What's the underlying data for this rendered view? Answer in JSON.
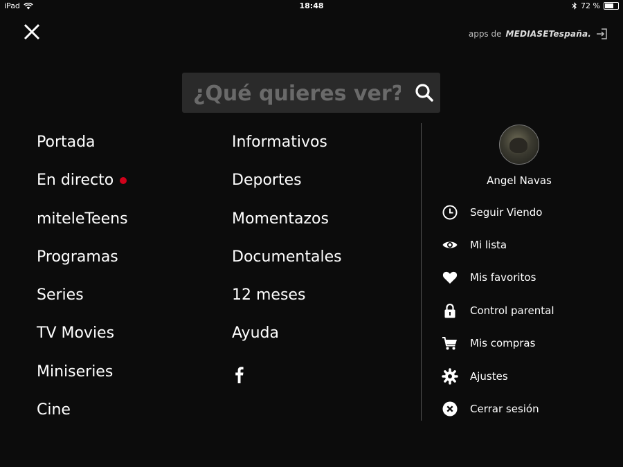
{
  "status_bar": {
    "device": "iPad",
    "time": "18:48",
    "battery_text": "72 %",
    "battery_level": 0.72
  },
  "header": {
    "brand_prefix": "apps de",
    "brand_name": "MEDIASETespaña."
  },
  "search": {
    "placeholder": "¿Qué quieres ver?"
  },
  "menu": {
    "column1": [
      {
        "label": "Portada"
      },
      {
        "label": "En directo",
        "live": true
      },
      {
        "label": "miteleTeens"
      },
      {
        "label": "Programas"
      },
      {
        "label": "Series"
      },
      {
        "label": "TV Movies"
      },
      {
        "label": "Miniseries"
      },
      {
        "label": "Cine"
      }
    ],
    "column2": [
      {
        "label": "Informativos"
      },
      {
        "label": "Deportes"
      },
      {
        "label": "Momentazos"
      },
      {
        "label": "Documentales"
      },
      {
        "label": "12 meses"
      },
      {
        "label": "Ayuda"
      }
    ],
    "social_icon": "facebook-icon"
  },
  "profile": {
    "name": "Angel Navas"
  },
  "account_menu": [
    {
      "label": "Seguir Viendo",
      "icon": "clock-icon"
    },
    {
      "label": "Mi lista",
      "icon": "eye-icon"
    },
    {
      "label": "Mis favoritos",
      "icon": "heart-icon"
    },
    {
      "label": "Control parental",
      "icon": "lock-icon"
    },
    {
      "label": "Mis compras",
      "icon": "cart-icon"
    },
    {
      "label": "Ajustes",
      "icon": "gear-icon"
    },
    {
      "label": "Cerrar sesión",
      "icon": "close-circle-icon"
    }
  ],
  "colors": {
    "background": "#0c0c0c",
    "live_dot": "#d0021b",
    "search_bg": "#2a2a2a"
  }
}
